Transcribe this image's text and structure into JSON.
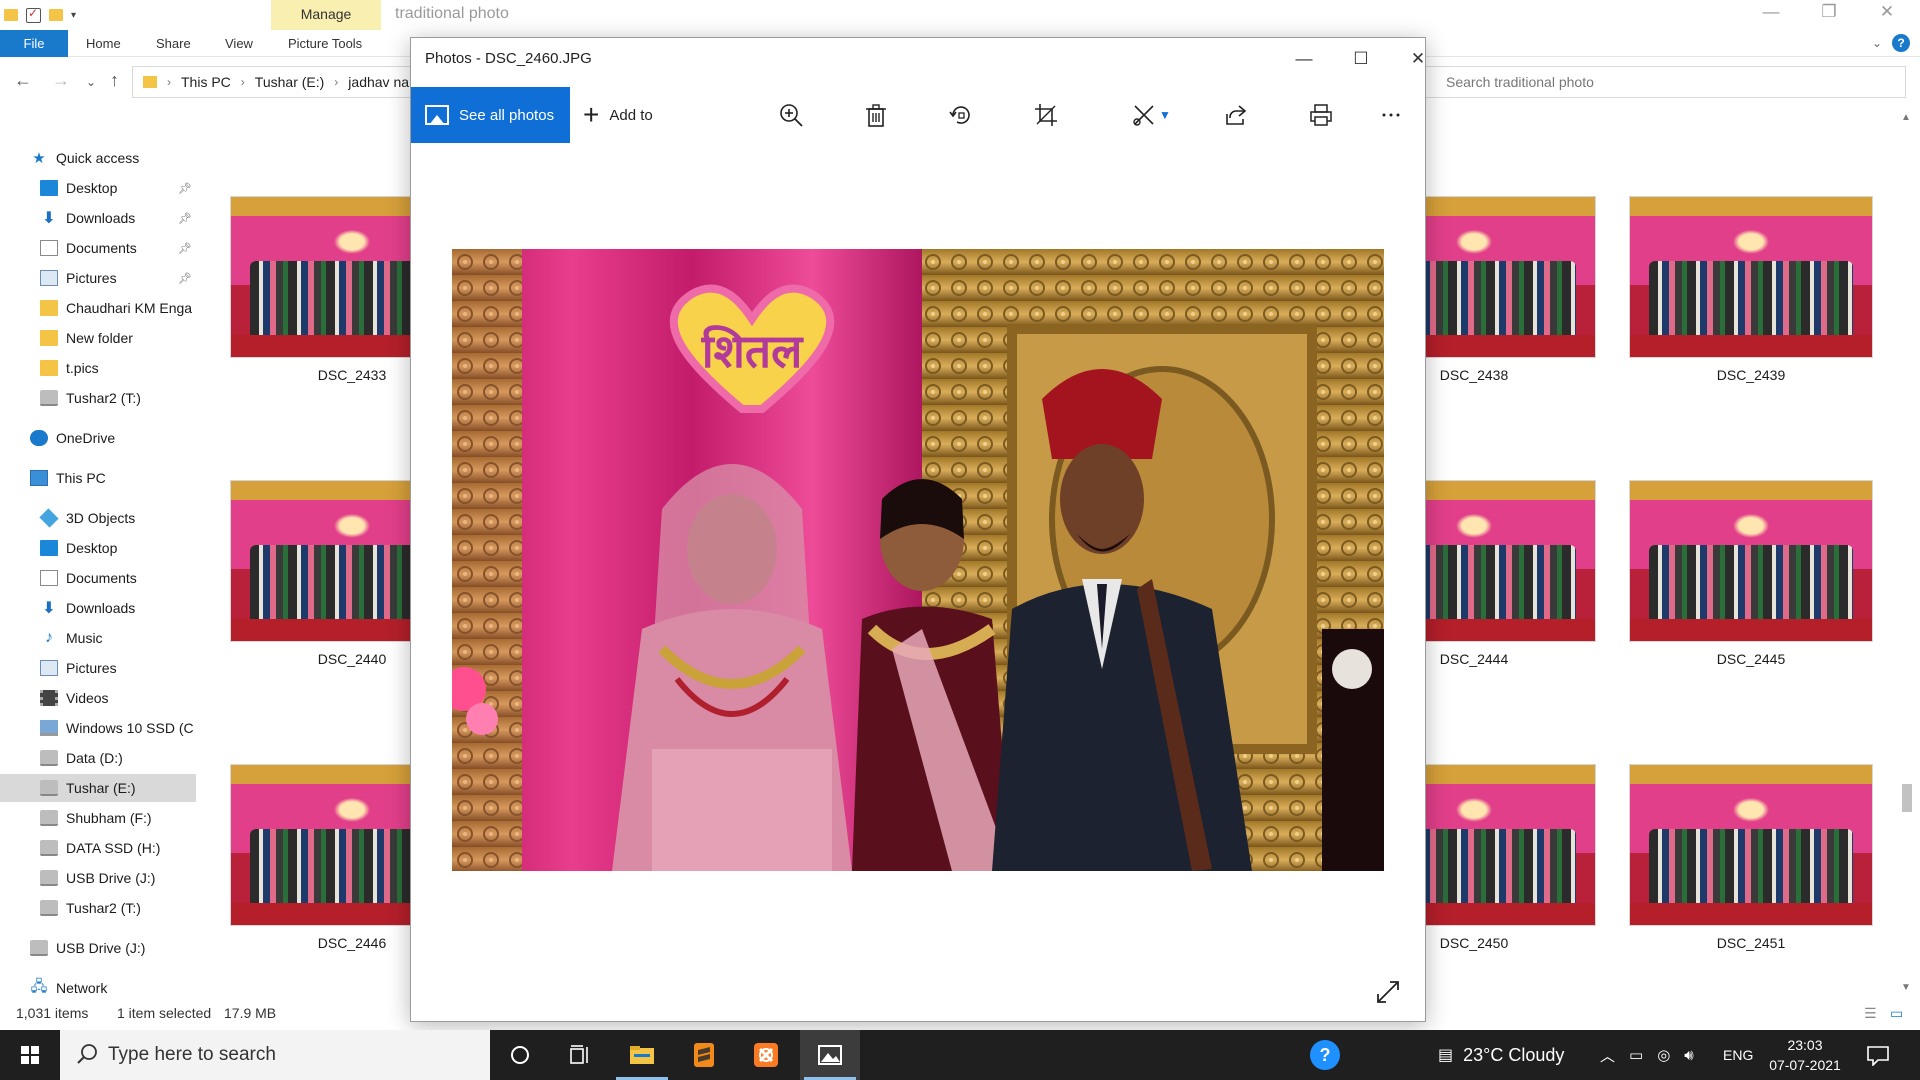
{
  "explorer": {
    "window_title": "traditional photo",
    "contextual_tab": "Manage",
    "tabs": [
      "File",
      "Home",
      "Share",
      "View",
      "Picture Tools"
    ],
    "breadcrumb": [
      "This PC",
      "Tushar (E:)",
      "jadhav na"
    ],
    "search_placeholder": "Search traditional photo",
    "nav": [
      {
        "label": "Quick access",
        "icon": "star-icon",
        "pinned": false,
        "indent": 0
      },
      {
        "label": "Desktop",
        "icon": "desktop-icon",
        "pinned": true,
        "indent": 1
      },
      {
        "label": "Downloads",
        "icon": "download-icon",
        "pinned": true,
        "indent": 1
      },
      {
        "label": "Documents",
        "icon": "document-icon",
        "pinned": true,
        "indent": 1
      },
      {
        "label": "Pictures",
        "icon": "pictures-icon",
        "pinned": true,
        "indent": 1
      },
      {
        "label": "Chaudhari KM Enga",
        "icon": "folder-icon",
        "pinned": false,
        "indent": 1
      },
      {
        "label": "New folder",
        "icon": "folder-icon",
        "pinned": false,
        "indent": 1
      },
      {
        "label": "t.pics",
        "icon": "folder-icon",
        "pinned": false,
        "indent": 1
      },
      {
        "label": "Tushar2 (T:)",
        "icon": "drive-icon",
        "pinned": false,
        "indent": 1
      },
      {
        "label": "OneDrive",
        "icon": "onedrive-icon",
        "pinned": false,
        "indent": 0
      },
      {
        "label": "This PC",
        "icon": "pc-icon",
        "pinned": false,
        "indent": 0
      },
      {
        "label": "3D Objects",
        "icon": "3d-objects-icon",
        "pinned": false,
        "indent": 1
      },
      {
        "label": "Desktop",
        "icon": "desktop-icon",
        "pinned": false,
        "indent": 1
      },
      {
        "label": "Documents",
        "icon": "document-icon",
        "pinned": false,
        "indent": 1
      },
      {
        "label": "Downloads",
        "icon": "download-icon",
        "pinned": false,
        "indent": 1
      },
      {
        "label": "Music",
        "icon": "music-icon",
        "pinned": false,
        "indent": 1
      },
      {
        "label": "Pictures",
        "icon": "pictures-icon",
        "pinned": false,
        "indent": 1
      },
      {
        "label": "Videos",
        "icon": "videos-icon",
        "pinned": false,
        "indent": 1
      },
      {
        "label": "Windows 10 SSD (C",
        "icon": "windows-drive-icon",
        "pinned": false,
        "indent": 1
      },
      {
        "label": "Data (D:)",
        "icon": "drive-icon",
        "pinned": false,
        "indent": 1
      },
      {
        "label": "Tushar (E:)",
        "icon": "drive-icon",
        "pinned": false,
        "indent": 1,
        "selected": true
      },
      {
        "label": "Shubham (F:)",
        "icon": "drive-icon",
        "pinned": false,
        "indent": 1
      },
      {
        "label": "DATA SSD (H:)",
        "icon": "drive-icon",
        "pinned": false,
        "indent": 1
      },
      {
        "label": "USB Drive (J:)",
        "icon": "drive-icon",
        "pinned": false,
        "indent": 1
      },
      {
        "label": "Tushar2 (T:)",
        "icon": "drive-icon",
        "pinned": false,
        "indent": 1
      },
      {
        "label": "USB Drive (J:)",
        "icon": "drive-icon",
        "pinned": false,
        "indent": 0
      },
      {
        "label": "Network",
        "icon": "network-icon",
        "pinned": false,
        "indent": 0
      }
    ],
    "thumbnails": [
      "DSC_2433",
      "DSC_2438",
      "DSC_2439",
      "DSC_2440",
      "DSC_2444",
      "DSC_2445",
      "DSC_2446",
      "DSC_2450",
      "DSC_2451"
    ],
    "status": {
      "count": "1,031 items",
      "selection": "1 item selected",
      "size": "17.9 MB"
    }
  },
  "photos": {
    "title": "Photos - DSC_2460.JPG",
    "see_all": "See all photos",
    "add_to": "Add to",
    "photo_text": "शितल",
    "toolbar_icons": [
      "zoom-in-icon",
      "delete-icon",
      "rotate-icon",
      "crop-icon",
      "edit-icon",
      "share-icon",
      "print-icon",
      "more-icon"
    ]
  },
  "taskbar": {
    "search_placeholder": "Type here to search",
    "weather": "23°C  Cloudy",
    "language": "ENG",
    "time": "23:03",
    "date": "07-07-2021"
  }
}
